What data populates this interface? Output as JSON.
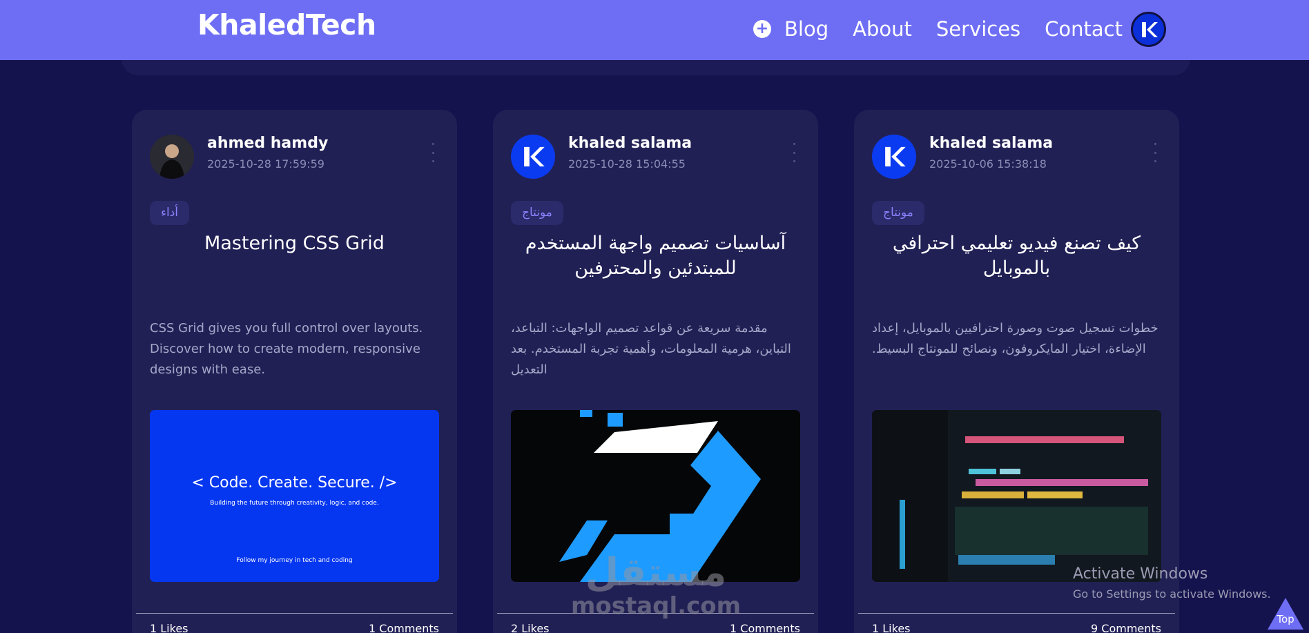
{
  "header": {
    "logo": "KhaledTech",
    "nav": [
      {
        "label": "Blog"
      },
      {
        "label": "About"
      },
      {
        "label": "Services"
      },
      {
        "label": "Contact"
      }
    ]
  },
  "posts": [
    {
      "author": "ahmed hamdy",
      "date": "2025-10-28 17:59:59",
      "tag": "أداء",
      "title": "Mastering CSS Grid",
      "excerpt": "CSS Grid gives you full control over layouts. Discover how to create modern, responsive designs with ease.",
      "thumb": {
        "headline": "< Code. Create. Secure. />",
        "subline": "Building the future through creativity, logic, and code.",
        "footer": "Follow my journey in tech and coding"
      },
      "likes": "1 Likes",
      "comments": "1 Comments"
    },
    {
      "author": "khaled salama",
      "date": "2025-10-28 15:04:55",
      "tag": "مونتاج",
      "title": "آساسيات تصميم واجهة المستخدم للمبتدئين والمحترفين",
      "excerpt": "مقدمة سريعة عن قواعد تصميم الواجهات: التباعد، التباين، هرمية المعلومات، وأهمية تجربة المستخدم. بعد التعديل",
      "likes": "2 Likes",
      "comments": "1 Comments"
    },
    {
      "author": "khaled salama",
      "date": "2025-10-06 15:38:18",
      "tag": "مونتاج",
      "title": "كيف تصنع فيديو تعليمي احترافي بالموبايل",
      "excerpt": "خطوات تسجيل صوت وصورة احترافيين بالموبايل، إعداد الإضاءة، اختيار المايكروفون، ونصائح للمونتاج البسيط.",
      "likes": "1 Likes",
      "comments": "9 Comments"
    }
  ],
  "watermark": {
    "arabic": "مستقل",
    "latin": "mostaql.com"
  },
  "activation": {
    "title": "Activate Windows",
    "subtitle": "Go to Settings to activate Windows."
  },
  "top_button": "Top",
  "colors": {
    "navbar": "#6e6ef5",
    "background": "#15134d",
    "card": "#212055",
    "tag_text": "#8b84ff"
  }
}
